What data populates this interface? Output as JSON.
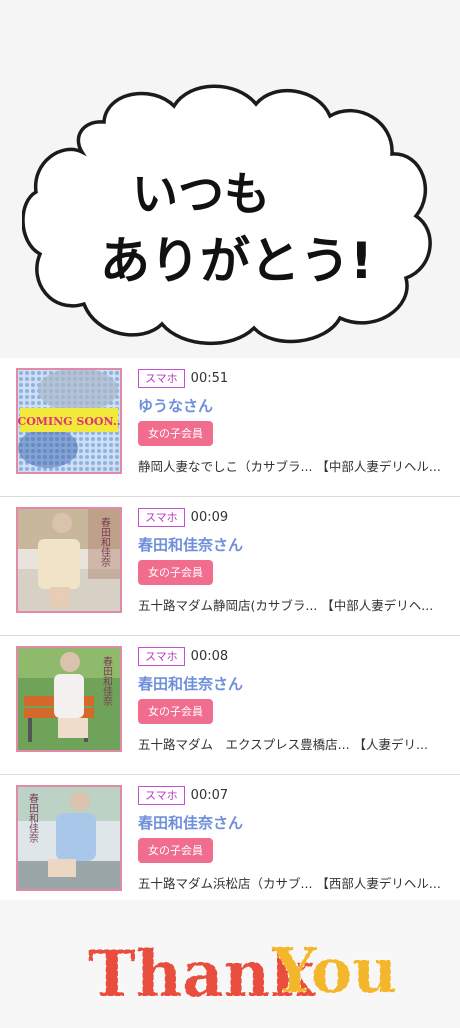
{
  "banner": {
    "line1": "いつも",
    "line2": "ありがとう!"
  },
  "entries": [
    {
      "device": "スマホ",
      "time": "00:51",
      "name": "ゆうなさん",
      "badge": "女の子会員",
      "shop": "静岡人妻なでしこ（カサブラ... 【中部人妻デリヘル...",
      "thumb_text": "COMING SOON.."
    },
    {
      "device": "スマホ",
      "time": "00:09",
      "name": "春田和佳奈さん",
      "badge": "女の子会員",
      "shop": "五十路マダム静岡店(カサブラ... 【中部人妻デリヘ...",
      "thumb_text": "春田和佳奈"
    },
    {
      "device": "スマホ",
      "time": "00:08",
      "name": "春田和佳奈さん",
      "badge": "女の子会員",
      "shop": "五十路マダム　エクスプレス豊橋店... 【人妻デリ...",
      "thumb_text": "春田和佳奈"
    },
    {
      "device": "スマホ",
      "time": "00:07",
      "name": "春田和佳奈さん",
      "badge": "女の子会員",
      "shop": "五十路マダム浜松店（カサブ... 【西部人妻デリヘル...",
      "thumb_text": "春田和佳奈"
    }
  ],
  "thanks": {
    "word1": "Thank",
    "word2": "You"
  }
}
